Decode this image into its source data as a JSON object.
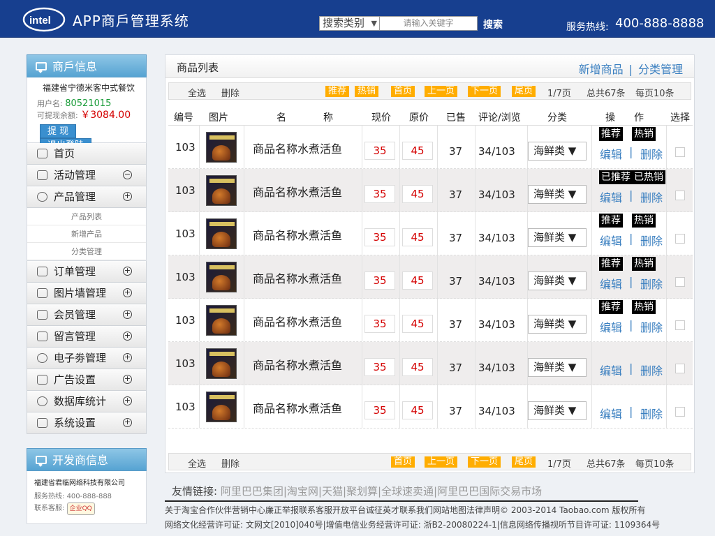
{
  "header": {
    "logo_text": "intel",
    "app_title": "APP商戶管理系统",
    "search_category": "搜索类别",
    "search_placeholder": "请输入关键字",
    "search_button": "搜索",
    "hotline_label": "服务热线:",
    "hotline_number": "400-888-8888"
  },
  "merchant": {
    "title": "商戶信息",
    "name": "福建省宁德米客中式餐饮",
    "account_label": "用户名:",
    "account_value": "80521015",
    "balance_label": "可提现余额:",
    "balance_value": "￥3084.00",
    "withdraw_button": "提  现",
    "logout_button": "退出登陆"
  },
  "nav": {
    "home": "首页",
    "activity": "活动管理",
    "product": "产品管理",
    "product_sub": [
      "产品列表",
      "新增产品",
      "分类管理"
    ],
    "order": "订单管理",
    "picwall": "图片墙管理",
    "member": "会员管理",
    "message": "留言管理",
    "coupon": "电子劵管理",
    "ads": "广告设置",
    "stats": "数据库统计",
    "settings": "系统设置"
  },
  "developer": {
    "title": "开发商信息",
    "name": "福建省君临网络科技有限公司",
    "phone_label": "服务热线:",
    "phone_value": "400-888-888",
    "qq_label": "联系客服:",
    "qq_badge": "企业QQ"
  },
  "main": {
    "title": "商品列表",
    "add_link": "新增商品",
    "category_link": "分类管理",
    "toolbar": {
      "select_all": "全选",
      "delete": "删除",
      "recommend": "推荐",
      "hot": "热销",
      "first": "首页",
      "prev": "上一页",
      "next": "下一页",
      "last": "尾页",
      "pages": "1/7页",
      "total": "总共67条",
      "per_page": "每页10条"
    },
    "columns": {
      "id": "编号",
      "image": "图片",
      "name1": "名",
      "name2": "称",
      "price": "现价",
      "orig": "原价",
      "sold": "已售",
      "comments": "评论/浏览",
      "category": "分类",
      "op1": "操",
      "op2": "作",
      "select": "选择"
    },
    "edit_label": "编辑",
    "delete_label": "删除",
    "rows": [
      {
        "id": "103",
        "name": "商品名称水煮活鱼",
        "price": "35",
        "orig": "45",
        "sold": "37",
        "stats": "34/103",
        "category": "海鲜类 ▼",
        "tag1": "推荐",
        "tag2": "热销"
      },
      {
        "id": "103",
        "name": "商品名称水煮活鱼",
        "price": "35",
        "orig": "45",
        "sold": "37",
        "stats": "34/103",
        "category": "海鲜类 ▼",
        "tag1": "已推荐",
        "tag2": "已热销"
      },
      {
        "id": "103",
        "name": "商品名称水煮活鱼",
        "price": "35",
        "orig": "45",
        "sold": "37",
        "stats": "34/103",
        "category": "海鲜类 ▼",
        "tag1": "推荐",
        "tag2": "热销"
      },
      {
        "id": "103",
        "name": "商品名称水煮活鱼",
        "price": "35",
        "orig": "45",
        "sold": "37",
        "stats": "34/103",
        "category": "海鲜类 ▼",
        "tag1": "推荐",
        "tag2": "热销"
      },
      {
        "id": "103",
        "name": "商品名称水煮活鱼",
        "price": "35",
        "orig": "45",
        "sold": "37",
        "stats": "34/103",
        "category": "海鲜类 ▼",
        "tag1": "推荐",
        "tag2": "热销"
      },
      {
        "id": "103",
        "name": "商品名称水煮活鱼",
        "price": "35",
        "orig": "45",
        "sold": "37",
        "stats": "34/103",
        "category": "海鲜类 ▼",
        "tag1": "",
        "tag2": ""
      },
      {
        "id": "103",
        "name": "商品名称水煮活鱼",
        "price": "35",
        "orig": "45",
        "sold": "37",
        "stats": "34/103",
        "category": "海鲜类 ▼",
        "tag1": "",
        "tag2": ""
      }
    ]
  },
  "footer": {
    "friend_label": "友情链接:",
    "friend_links": "阿里巴巴集团|淘宝网|天猫|聚划算|全球速卖通|阿里巴巴国际交易市场",
    "line1": "关于淘宝合作伙伴营销中心廉正举报联系客服开放平台诚征英才联系我们网站地图法律声明© 2003-2014 Taobao.com 版权所有",
    "line2": "网络文化经营许可证: 文网文[2010]040号|增值电信业务经营许可证: 浙B2-20080224-1|信息网络传播视听节目许可证: 1109364号"
  }
}
